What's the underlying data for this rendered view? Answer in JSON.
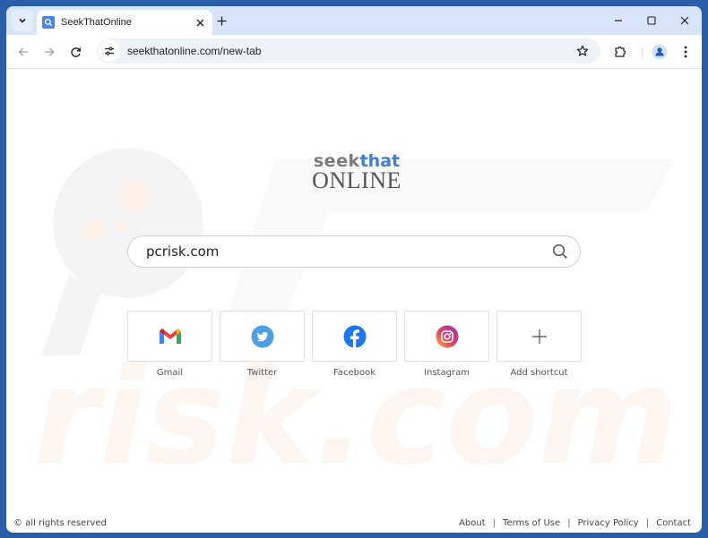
{
  "browser": {
    "tab_title": "SeekThatOnline",
    "url": "seekthatonline.com/new-tab",
    "icons": {
      "tab_menu": "chevron-down-icon",
      "favicon": "search-icon",
      "tab_close": "close-icon",
      "new_tab": "plus-icon",
      "minimize": "minimize-icon",
      "maximize": "maximize-icon",
      "close": "close-icon",
      "back": "arrow-left-icon",
      "forward": "arrow-right-icon",
      "reload": "reload-icon",
      "site_info": "tune-icon",
      "bookmark": "star-icon",
      "extensions": "puzzle-icon",
      "profile": "person-icon",
      "menu": "kebab-menu-icon"
    }
  },
  "page": {
    "logo": {
      "seek": "seek",
      "that": "that",
      "online": "ONLINE"
    },
    "search": {
      "value": "pcrisk.com",
      "icon": "search-icon"
    },
    "shortcuts": [
      {
        "label": "Gmail",
        "icon": "gmail-icon"
      },
      {
        "label": "Twitter",
        "icon": "twitter-icon"
      },
      {
        "label": "Facebook",
        "icon": "facebook-icon"
      },
      {
        "label": "Instagram",
        "icon": "instagram-icon"
      },
      {
        "label": "Add shortcut",
        "icon": "plus-icon"
      }
    ],
    "footer": {
      "copyright": "© all rights reserved",
      "links": [
        "About",
        "Terms of Use",
        "Privacy Policy",
        "Contact"
      ],
      "separator": "|"
    },
    "watermark": {
      "text": "risk.com"
    }
  },
  "colors": {
    "frame": "#2b5ea8",
    "tabbar": "#d8e4f8",
    "brand_blue": "#3f7ed6",
    "brand_gray": "#7b7b7b"
  }
}
